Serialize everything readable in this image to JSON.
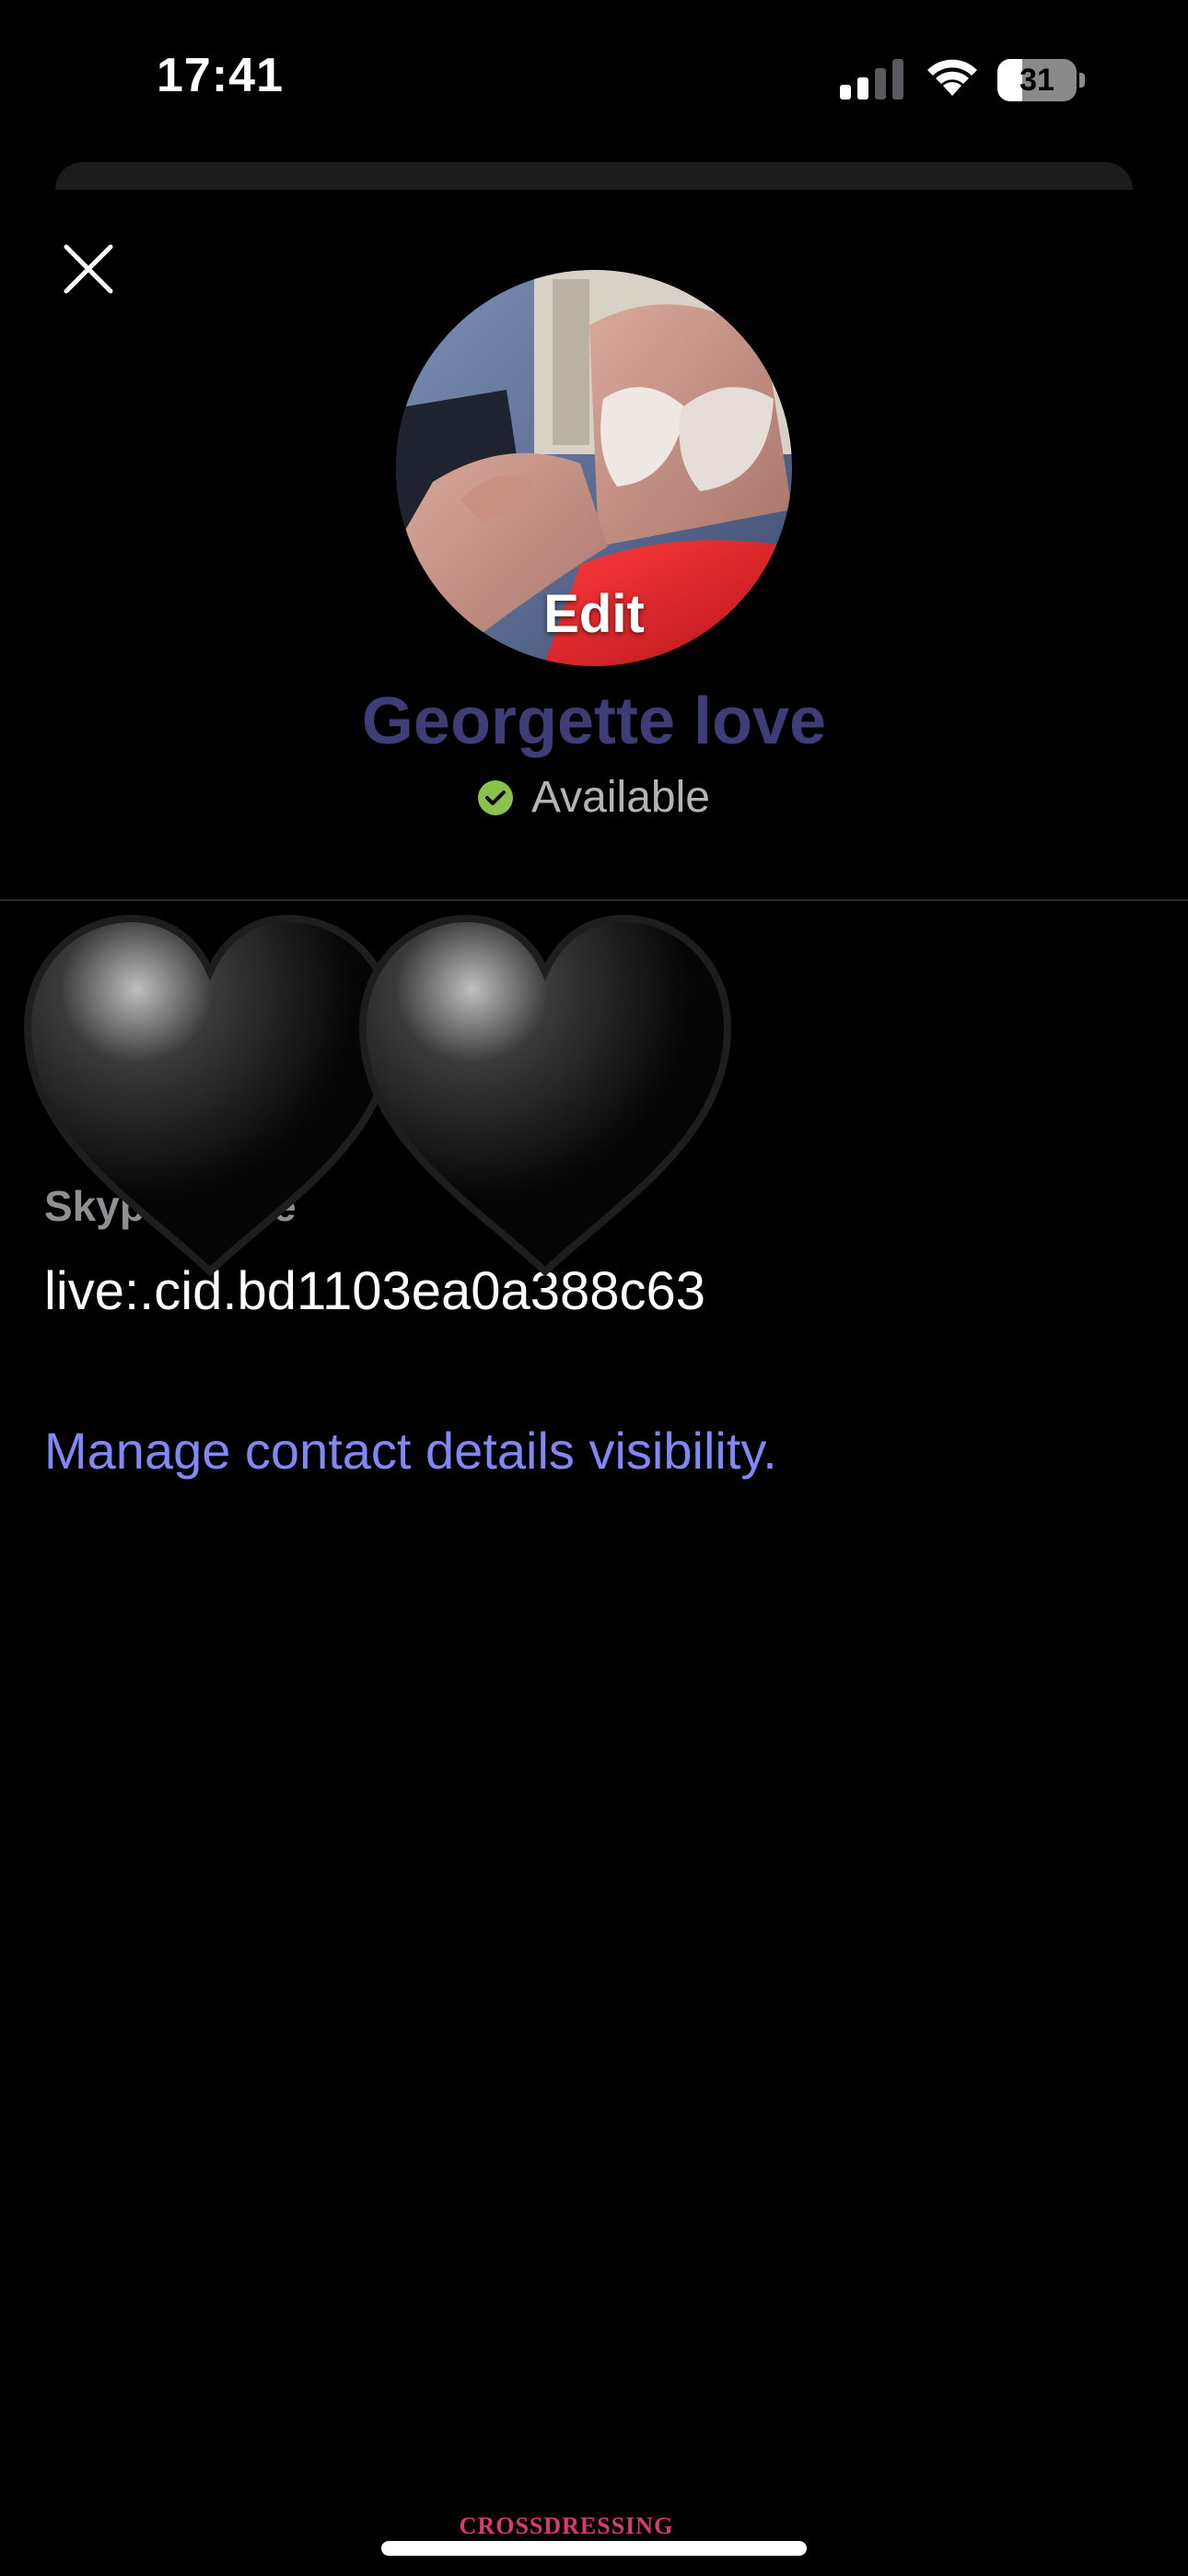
{
  "status_bar": {
    "time": "17:41",
    "battery_level": "31",
    "battery_fraction": 0.31,
    "icons": [
      "signal-icon",
      "wifi-icon",
      "battery-icon"
    ]
  },
  "sheet": {
    "close_icon": "close-icon"
  },
  "profile": {
    "avatar_edit_label": "Edit",
    "display_name": "Georgette love",
    "presence_status": "Available",
    "presence_icon": "check-circle-icon"
  },
  "contact": {
    "label": "Skype Name",
    "value": "live:.cid.bd1103ea0a388c63",
    "manage_link": "Manage contact details visibility."
  },
  "stickers": [
    "black-heart-icon",
    "black-heart-icon"
  ],
  "watermark": "CROSSDRESSING",
  "colors": {
    "background": "#000000",
    "display_name": "#3f3d78",
    "presence_text": "#b4b4b8",
    "presence_check": "#8bc34a",
    "link": "#8387f5",
    "label": "#8e8e93",
    "watermark": "#d63a6e"
  }
}
